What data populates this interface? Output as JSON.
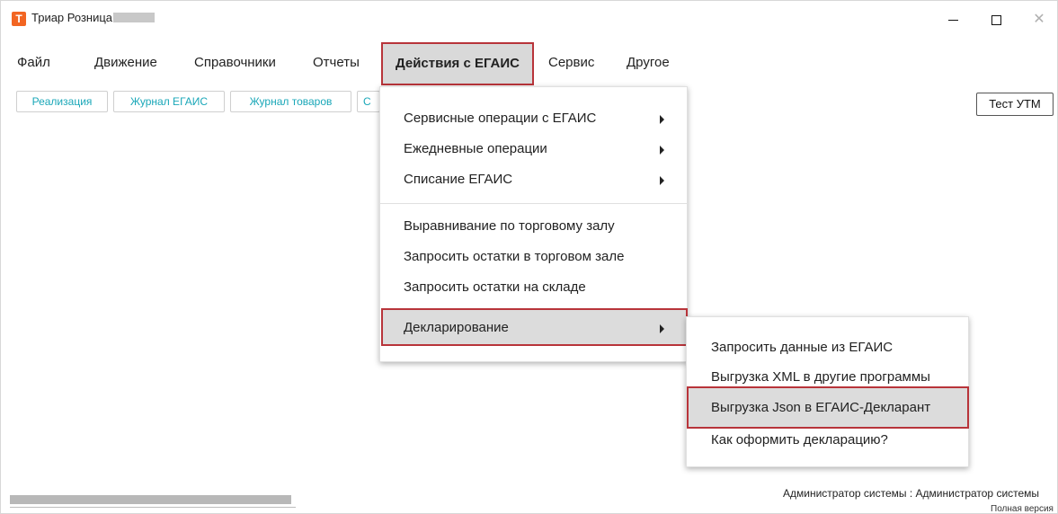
{
  "window": {
    "title": "Триар Розница",
    "app_icon_letter": "Т",
    "controls": {
      "minimize_icon": "minimize-icon",
      "maximize_icon": "maximize-icon",
      "close_icon": "close-icon",
      "close_glyph": "✕"
    }
  },
  "menubar": {
    "items": [
      {
        "label": "Файл"
      },
      {
        "label": "Движение"
      },
      {
        "label": "Справочники"
      },
      {
        "label": "Отчеты"
      },
      {
        "label": "Действия с ЕГАИС"
      },
      {
        "label": "Сервис"
      },
      {
        "label": "Другое"
      }
    ]
  },
  "toolbar": {
    "buttons": [
      {
        "label": "Реализация"
      },
      {
        "label": "Журнал ЕГАИС"
      },
      {
        "label": "Журнал товаров"
      },
      {
        "label": "С"
      }
    ],
    "test_utm_label": "Тест УТМ"
  },
  "dropdown": {
    "items": [
      {
        "label": "Сервисные операции с ЕГАИС",
        "has_submenu": true
      },
      {
        "label": "Ежедневные операции",
        "has_submenu": true
      },
      {
        "label": "Списание ЕГАИС",
        "has_submenu": true
      },
      {
        "label": "Выравнивание по торговому залу",
        "has_submenu": false
      },
      {
        "label": "Запросить остатки в торговом зале",
        "has_submenu": false
      },
      {
        "label": "Запросить остатки на складе",
        "has_submenu": false
      },
      {
        "label": "Декларирование",
        "has_submenu": true
      }
    ]
  },
  "submenu": {
    "items": [
      {
        "label": "Запросить данные из ЕГАИС"
      },
      {
        "label": "Выгрузка XML в другие программы"
      },
      {
        "label": "Выгрузка Json в ЕГАИС-Декларант"
      },
      {
        "label": "Как оформить декларацию?"
      }
    ]
  },
  "footer": {
    "user": "Администратор системы : Администратор системы",
    "version": "Полная версия"
  },
  "colors": {
    "accent_teal": "#1aa7b8",
    "highlight_border": "#b8343a",
    "app_icon": "#f26522"
  }
}
